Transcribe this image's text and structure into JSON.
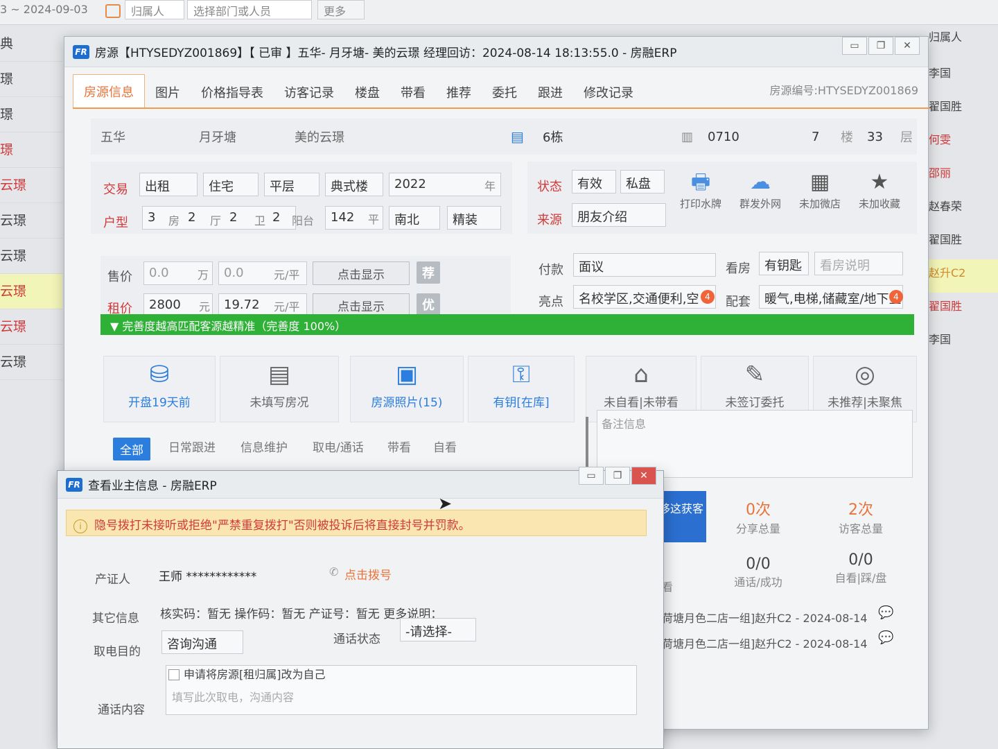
{
  "background": {
    "date_range": "3 ~ 2024-09-03",
    "belong_select": "归属人",
    "dept_select": "选择部门或人员",
    "more_label": "更多",
    "left_rows": [
      {
        "text": "典",
        "style": ""
      },
      {
        "text": "璟",
        "style": ""
      },
      {
        "text": "璟",
        "style": ""
      },
      {
        "text": "璟",
        "style": "red"
      },
      {
        "text": "云璟",
        "style": "red"
      },
      {
        "text": "云璟",
        "style": ""
      },
      {
        "text": "云璟",
        "style": ""
      },
      {
        "text": "云璟",
        "style": "red hl"
      },
      {
        "text": "云璟",
        "style": "red"
      },
      {
        "text": "云璟",
        "style": ""
      }
    ],
    "right_header": "归属人",
    "right_rows": [
      {
        "text": "李国",
        "style": ""
      },
      {
        "text": "翟国胜",
        "style": ""
      },
      {
        "text": "何雯",
        "style": "red"
      },
      {
        "text": "邵丽",
        "style": "red"
      },
      {
        "text": "赵春荣",
        "style": ""
      },
      {
        "text": "翟国胜",
        "style": ""
      },
      {
        "text": "赵升C2",
        "style": "hl"
      },
      {
        "text": "翟国胜",
        "style": "red"
      },
      {
        "text": "李国",
        "style": ""
      }
    ]
  },
  "main_window": {
    "logo": "FR",
    "title": "房源【HTYSEDYZ001869】【 已审 】五华- 月牙塘- 美的云璟 经理回访：2024-08-14 18:13:55.0 - 房融ERP",
    "controls": [
      "▭",
      "❐",
      "✕"
    ],
    "tabs": [
      "房源信息",
      "图片",
      "价格指导表",
      "访客记录",
      "楼盘",
      "带看",
      "推荐",
      "委托",
      "跟进",
      "修改记录"
    ],
    "house_no": "房源编号:HTYSEDYZ001869",
    "address": {
      "district": "五华",
      "area": "月牙塘",
      "estate": "美的云璟",
      "building_icon": "building-icon",
      "building": "6栋",
      "room_icon": "door-icon",
      "room": "0710",
      "floor": "7",
      "floor_unit": "楼",
      "total_floors": "33",
      "total_floors_unit": "层"
    },
    "trade": {
      "label_trade": "交易",
      "label_layout": "户型",
      "trade_type": "出租",
      "use": "住宅",
      "decor_type": "平层",
      "building_type": "典式楼",
      "year": "2022",
      "year_unit": "年",
      "rooms": "3",
      "rooms_unit": "房",
      "halls": "2",
      "halls_unit": "厅",
      "baths": "2",
      "baths_unit": "卫",
      "balconies": "2",
      "balconies_unit": "阳台",
      "area": "142",
      "area_unit": "平",
      "orientation": "南北",
      "fitment": "精装"
    },
    "status": {
      "label_status": "状态",
      "label_source": "来源",
      "status": "有效",
      "private": "私盘",
      "source": "朋友介绍",
      "actions": [
        {
          "icon": "printer-icon",
          "glyph": "🖶",
          "label": "打印水牌"
        },
        {
          "icon": "cloud-share-icon",
          "glyph": "☁",
          "label": "群发外网"
        },
        {
          "icon": "shop-icon",
          "glyph": "▦",
          "label": "未加微店"
        },
        {
          "icon": "star-icon",
          "glyph": "★",
          "label": "未加收藏"
        }
      ]
    },
    "price": {
      "label_sale": "售价",
      "label_rent": "租价",
      "sale_total": "0.0",
      "sale_total_unit": "万",
      "sale_unit_price": "0.0",
      "sale_unit_price_unit": "元/平",
      "rent_total": "2800",
      "rent_total_unit": "元",
      "rent_unit_price": "19.72",
      "rent_unit_price_unit": "元/平",
      "show_btn": "点击显示",
      "tag_recommend": "荐",
      "tag_premium": "优",
      "label_pay": "付款",
      "pay": "面议",
      "label_highlight": "亮点",
      "highlight": "名校学区,交通便利,空",
      "highlight_count": "4",
      "label_viewing": "看房",
      "viewing": "有钥匙",
      "viewing_note_placeholder": "看房说明",
      "label_facility": "配套",
      "facility": "暖气,电梯,储藏室/地下室",
      "facility_count": "4"
    },
    "progress_text": "▼  完善度越高匹配客源越精准（完善度 100%）",
    "cards": [
      {
        "icon": "stack-coins-icon",
        "glyph": "⛁",
        "label": "开盘19天前",
        "active": true
      },
      {
        "icon": "calendar-icon",
        "glyph": "▤",
        "label": "未填写房况",
        "active": false
      },
      {
        "icon": "image-icon",
        "glyph": "▣",
        "label": "房源照片(15)",
        "active": true
      },
      {
        "icon": "key-icon",
        "glyph": "⚿",
        "label": "有钥[在库]",
        "active": true
      },
      {
        "icon": "home-icon",
        "glyph": "⌂",
        "label": "未自看|未带看",
        "active": false
      },
      {
        "icon": "contract-icon",
        "glyph": "✎",
        "label": "未签订委托",
        "active": false
      },
      {
        "icon": "target-icon",
        "glyph": "◎",
        "label": "未推荐|未聚焦",
        "active": false
      }
    ],
    "filters": [
      "全部",
      "日常跟进",
      "信息维护",
      "取电/通话",
      "带看",
      "自看"
    ],
    "remark_placeholder": "备注信息",
    "move_box": "移这获客",
    "stats": [
      {
        "num": "0次",
        "label": "分享总量",
        "red": true
      },
      {
        "num": "2次",
        "label": "访客总量",
        "red": true
      },
      {
        "num": "0/0",
        "label": "通话/成功",
        "red": false
      },
      {
        "num": "0/0",
        "label": "自看|踩/盘",
        "red": false
      }
    ],
    "partial_label": "看",
    "logs": [
      "荷塘月色二店一组]赵升C2 - 2024-08-14",
      "荷塘月色二店一组]赵升C2 - 2024-08-14"
    ]
  },
  "dialog": {
    "logo": "FR",
    "title": "查看业主信息 - 房融ERP",
    "controls": [
      "▭",
      "❐",
      "✕"
    ],
    "warning": "隐号拨打未接听或拒绝\"严禁重复拨打\"否则被投诉后将直接封号并罚款。",
    "label_owner": "产证人",
    "owner": "王师 ************",
    "dial": "点击拨号",
    "label_other": "其它信息",
    "other_info": "核实码：暂无    操作码：暂无    产证号：暂无    更多说明：",
    "label_purpose": "取电目的",
    "purpose": "咨询沟通",
    "label_call_status": "通话状态",
    "call_status": "-请选择-",
    "checkbox_label": "申请将房源[租归属]改为自己",
    "label_content": "通话内容",
    "content_placeholder": "填写此次取电，沟通内容"
  }
}
